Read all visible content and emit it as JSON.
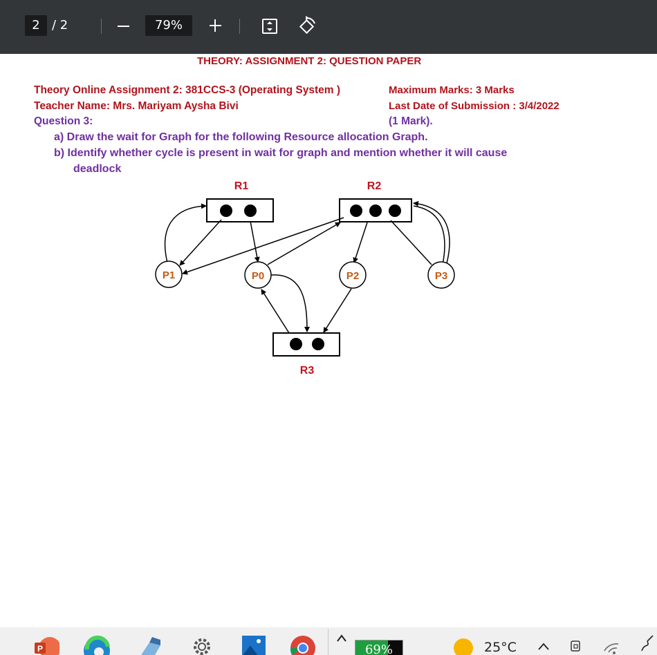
{
  "viewer": {
    "page_current": "2",
    "page_total": "/ 2",
    "zoom": "79%"
  },
  "document": {
    "title": "THEORY: ASSIGNMENT 2: QUESTION PAPER",
    "course_line": "Theory Online Assignment 2: 381CCS-3 (Operating System )",
    "max_marks": "Maximum Marks: 3 Marks",
    "teacher": "Teacher Name:  Mrs. Mariyam Aysha Bivi",
    "last_date": "Last Date of Submission : 3/4/2022",
    "question": "Question 3:",
    "marks": "(1 Mark).",
    "item_a": "a)  Draw the wait for Graph for the following Resource allocation Graph.",
    "item_b": "b)  Identify whether cycle is present in wait for graph and mention whether it will cause",
    "item_b_cont": "deadlock"
  },
  "diagram": {
    "resources": [
      "R1",
      "R2",
      "R3"
    ],
    "processes": [
      "P1",
      "P0",
      "P2",
      "P3"
    ],
    "colors": {
      "label": "#c0141c",
      "process_label": "#c55a11",
      "node_fill": "#ffffff"
    }
  },
  "taskbar": {
    "battery": "69%",
    "battery_level": 0.69,
    "temperature": "25°C",
    "icons": [
      "powerpoint-icon",
      "edge-icon",
      "notepad-icon",
      "settings-gear-icon",
      "photos-icon",
      "chrome-icon",
      "chevron-up-icon",
      "weather-sun-icon",
      "caret-up-icon",
      "camera-icon",
      "wifi-icon",
      "pen-icon"
    ]
  }
}
